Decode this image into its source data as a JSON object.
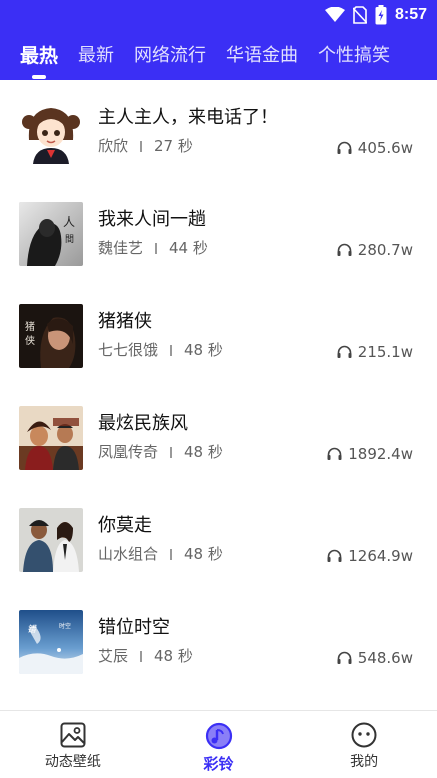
{
  "status_bar": {
    "time": "8:57"
  },
  "tabs": [
    {
      "label": "最热",
      "active": true
    },
    {
      "label": "最新",
      "active": false
    },
    {
      "label": "网络流行",
      "active": false
    },
    {
      "label": "华语金曲",
      "active": false
    },
    {
      "label": "个性搞笑",
      "active": false
    }
  ],
  "songs": [
    {
      "title": "主人主人，来电话了！",
      "artist": "欣欣",
      "duration": "27 秒",
      "plays": "405.6w"
    },
    {
      "title": "我来人间一趟",
      "artist": "魏佳艺",
      "duration": "44 秒",
      "plays": "280.7w"
    },
    {
      "title": "猪猪侠",
      "artist": "七七很饿",
      "duration": "48 秒",
      "plays": "215.1w"
    },
    {
      "title": "最炫民族风",
      "artist": "凤凰传奇",
      "duration": "48 秒",
      "plays": "1892.4w"
    },
    {
      "title": "你莫走",
      "artist": "山水组合",
      "duration": "48 秒",
      "plays": "1264.9w"
    },
    {
      "title": "错位时空",
      "artist": "艾辰",
      "duration": "48 秒",
      "plays": "548.6w"
    }
  ],
  "bottom_nav": [
    {
      "label": "动态壁纸",
      "icon": "image-icon",
      "active": false
    },
    {
      "label": "彩铃",
      "icon": "music-disc-icon",
      "active": true
    },
    {
      "label": "我的",
      "icon": "face-icon",
      "active": false
    }
  ],
  "colors": {
    "accent": "#3b2ff5"
  }
}
